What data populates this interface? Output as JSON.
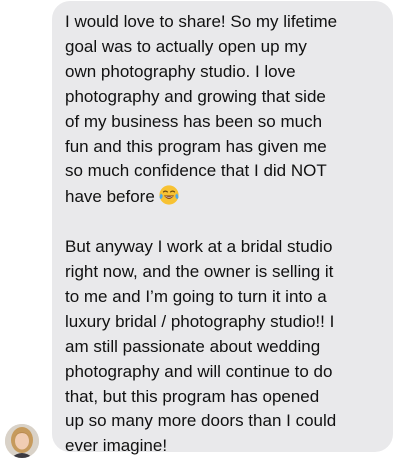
{
  "message": {
    "paragraph_1": "I would love to share! So my lifetime\ngoal was to actually open up my\nown photography studio. I love\nphotography and growing that side\nof my business has been so much\nfun and this program has given me\nso much confidence that I did NOT\nhave before",
    "emoji_icon": "face-with-tears-of-joy-icon",
    "paragraph_2": "But anyway I work at a bridal studio\nright now, and the owner is selling it\nto me and I’m going to turn it into a\nluxury bridal / photography studio!! I\nam still passionate about wedding\nphotography and will continue to do\nthat, but this program has opened\nup so many more doors than I could\never imagine!"
  },
  "sender": {
    "avatar_icon": "user-avatar"
  },
  "colors": {
    "bubble_background": "#e9e9eb",
    "text": "#111111",
    "page_background": "#ffffff"
  }
}
